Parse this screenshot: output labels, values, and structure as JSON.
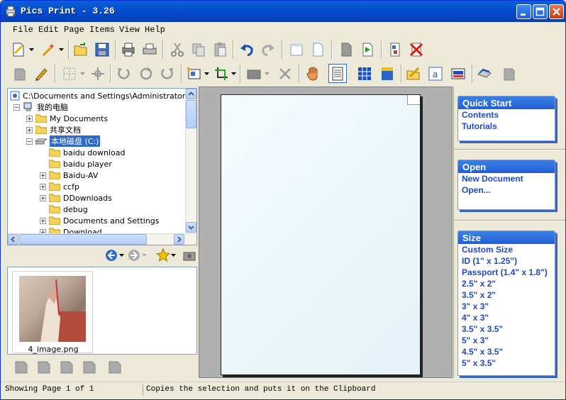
{
  "window": {
    "title": "Pics Print - 3.26"
  },
  "menu": {
    "items": [
      "File",
      "Edit",
      "Page",
      "Items",
      "View",
      "Help"
    ]
  },
  "toolbar1": {
    "icons": [
      "new-icon",
      "wand-icon",
      "open-icon",
      "save-icon",
      "print-preview-icon",
      "print-icon",
      "cut-icon",
      "copy-icon",
      "paste-icon",
      "undo-icon",
      "redo-icon",
      "page-blank-icon",
      "page-icon",
      "page-gray-icon",
      "next-page-icon",
      "page-layout-icon",
      "delete-page-icon"
    ]
  },
  "toolbar2": {
    "icons": [
      "item-icon",
      "pencil-icon",
      "grid-icon",
      "pin-icon",
      "rotate-left-icon",
      "rotate-icon",
      "rotate-right-icon",
      "align-icon",
      "crop-icon",
      "fill-icon",
      "delete-icon",
      "hand-icon",
      "doc-view-icon",
      "grid-view-icon",
      "clipboard-icon",
      "folder-open-icon",
      "text-icon",
      "image-icon",
      "scanner-icon",
      "item2-icon"
    ]
  },
  "tree": {
    "path": "C:\\Documents and Settings\\Administrator\\桌面",
    "items": [
      {
        "label": "我的电脑",
        "expander": "−"
      },
      {
        "label": "My Documents",
        "expander": "+"
      },
      {
        "label": "共享文档",
        "expander": "+"
      },
      {
        "label": "本地磁盘 (C:)",
        "expander": "−"
      },
      {
        "label": "baidu download",
        "expander": ""
      },
      {
        "label": "baidu player",
        "expander": ""
      },
      {
        "label": "Baidu-AV",
        "expander": "+"
      },
      {
        "label": "ccfp",
        "expander": "+"
      },
      {
        "label": "DDownloads",
        "expander": "+"
      },
      {
        "label": "debug",
        "expander": ""
      },
      {
        "label": "Documents and Settings",
        "expander": "+"
      },
      {
        "label": "Download",
        "expander": "+"
      }
    ]
  },
  "thumbnails": [
    {
      "label": "4_image.png"
    }
  ],
  "panels": {
    "quick_start": {
      "title": "Quick Start",
      "items": [
        "Contents",
        "Tutorials"
      ]
    },
    "open": {
      "title": "Open",
      "items": [
        "New Document",
        "Open..."
      ]
    },
    "size": {
      "title": "Size",
      "items": [
        "Custom Size",
        "ID (1\" x 1.25\")",
        "Passport (1.4\" x 1.8\")",
        "2.5\" x 2\"",
        "3.5\" x 2\"",
        "3\" x 3\"",
        "4\" x 3\"",
        "3.5\" x 3.5\"",
        "5\" x 3\"",
        "4.5\" x 3.5\"",
        "5\" x 3.5\""
      ]
    }
  },
  "status": {
    "page": "Showing Page 1 of 1",
    "message": "Copies the selection and puts it on the Clipboard"
  }
}
